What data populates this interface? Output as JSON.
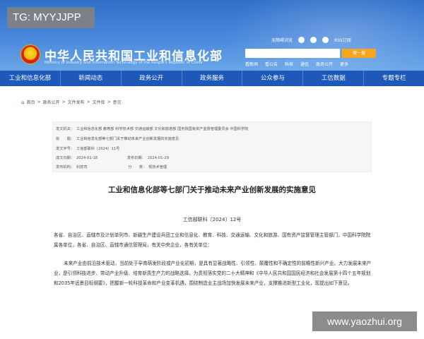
{
  "overlay": {
    "tg_label": "TG: MYYJJPP",
    "watermark": "www.yaozhui.org"
  },
  "header": {
    "top_links": [
      {
        "label": "无障碍浏览",
        "icon": "accessibility-icon"
      },
      {
        "label": "",
        "icon": "mobile-icon"
      },
      {
        "label": "",
        "icon": "weibo-icon"
      },
      {
        "label": "",
        "icon": "wechat-icon"
      },
      {
        "label": "RSS订阅",
        "icon": "rss-icon"
      }
    ],
    "title": "中华人民共和国工业和信息化部",
    "subtitle": "Ministry of Industry and Information Technology of the People's Republic of China",
    "search_placeholder": "",
    "search_button": "搜一搜",
    "hot_words": [
      "看新闻",
      "看公告",
      "科技",
      "通信",
      "政务公开",
      "更多"
    ]
  },
  "nav": {
    "items": [
      "工业和信息化部",
      "新闻动态",
      "政务公开",
      "政务服务",
      "公众参与",
      "工信数据",
      "专题专栏"
    ]
  },
  "breadcrumb": [
    "首页",
    "政务公开",
    "文件发布",
    "文件库",
    "意见"
  ],
  "meta": {
    "issuer_label": "发文机关：",
    "issuer_value": "工业和信息化部 教育部 科学技术部 交通运输部 文化和旅游部 国务院国有资产监督管理委员会 中国科学院",
    "subject_label": "标　　题：",
    "subject_value": "工业和信息化部等七部门关于推动未来产业创新发展的实施意见",
    "doc_no_label": "发文字号：",
    "doc_no_value": "工信部联科〔2024〕11号",
    "date_label": "成文日期：",
    "date_value": "2024-01-18",
    "publish_label": "发布日期：",
    "publish_value": "2024-01-29",
    "org_label": "发布机构：",
    "org_value": "科技司",
    "category_label": "分　　类：",
    "category_value": "规技术管理"
  },
  "document": {
    "title": "工业和信息化部等七部门关于推动未来产业创新发展的实施意见",
    "number": "工信部联科〔2024〕12号",
    "para1": "各省、自治区、直辖市及计划单列市、新疆生产建设兵团工业和信息化、教育、科技、交通运输、文化和旅游、国有资产监督管理主管部门，中国科学院院属各单位，各省、自治区、直辖市通信管理局，有关中央企业，各有关单位：",
    "para2": "未来产业由前沿技术驱动，当前处于孕育萌发阶段或产业化初期，是具有显著战略性、引领性、颠覆性和不确定性的前瞻性新兴产业。大力发展未来产业，是引领科技进步、带动产业升级、培育新质生产力的战略选择。为贯彻落实党的二十大精神和《中华人民共和国国民经济和社会发展第十四个五年规划和2035年远景目标纲要》，把握新一轮科技革命和产业变革机遇，围绕制造业主战场加快发展未来产业，支撑推进新型工业化，现提出如下意见。"
  },
  "colors": {
    "header_blue": "#3c7ad0",
    "nav_blue": "#1e58b8",
    "search_orange": "#f4a61e"
  }
}
